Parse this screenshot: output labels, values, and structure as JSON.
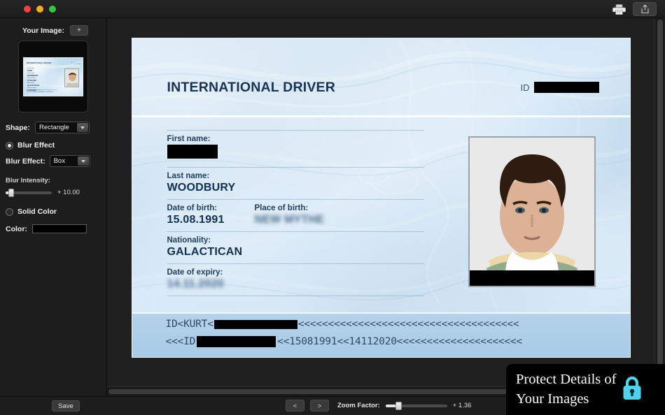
{
  "window": {
    "traffic_lights": [
      "close",
      "minimize",
      "maximize"
    ],
    "titlebar_icons": [
      "printer-icon",
      "share-export-icon"
    ]
  },
  "sidebar": {
    "your_image_label": "Your Image:",
    "add_image_label": "+",
    "shape_label": "Shape:",
    "shape_value": "Rectangle",
    "blur_effect_radio_label": "Blur Effect",
    "blur_effect_radio_selected": true,
    "blur_effect_label": "Blur Effect:",
    "blur_effect_value": "Box",
    "blur_intensity_label": "Blur Intensity:",
    "blur_intensity_value": "+ 10.00",
    "solid_color_radio_label": "Solid Color",
    "solid_color_radio_selected": false,
    "color_label": "Color:",
    "color_value": "#000000",
    "thumbnail": {
      "title": "INTERNATIONAL  DRIVER",
      "id_text": "ID ________",
      "labels": [
        "First name:",
        "Last name:",
        "Date of birth:",
        "Place of birth:",
        "Nationality:",
        "Date of expiry:"
      ],
      "values": [
        "KURT",
        "WOODBURY",
        "15.08.1991",
        "NEW MYTHE",
        "GALACTICAN",
        "14.11.2020"
      ],
      "mrz_1": "ID<KURT<WOODBURY<<<<<<<<<<<<<<<<<<<",
      "mrz_2": "<<<ID 1234567<<15081991<<14112020<<<"
    }
  },
  "card": {
    "title": "INTERNATIONAL DRIVER",
    "id_label": "ID",
    "id_redacted": true,
    "fields": [
      {
        "label": "First name:",
        "value": "",
        "redacted": true,
        "blurred": false
      },
      {
        "label": "Last name:",
        "value": "WOODBURY",
        "redacted": false,
        "blurred": false
      },
      {
        "label": "Date of birth:",
        "value": "15.08.1991",
        "redacted": false,
        "blurred": false
      },
      {
        "label": "Place of birth:",
        "value": "NEW MYTHE",
        "redacted": false,
        "blurred": true
      },
      {
        "label": "Nationality:",
        "value": "GALACTICAN",
        "redacted": false,
        "blurred": false
      },
      {
        "label": "Date of expiry:",
        "value": "14.11.2020",
        "redacted": false,
        "blurred": true
      }
    ],
    "mrz": {
      "line1_prefix": "ID<KURT<",
      "line1_suffix": "<<<<<<<<<<<<<<<<<<<<<<<<<<<<<<<<<<<<<",
      "line2_prefix": "<<<ID ",
      "line2_suffix": "<<15081991<<14112020<<<<<<<<<<<<<<<<<<<<<"
    },
    "photo_redacted": true
  },
  "bottombar": {
    "save_label": "Save",
    "prev_label": "<",
    "next_label": ">",
    "zoom_factor_label": "Zoom Factor:",
    "zoom_factor_value": "+ 1.36"
  },
  "watermark": {
    "line1": "Protect Details of",
    "line2": "Your Images",
    "lock_icon": "lock-icon",
    "lock_color": "#4fd2ea"
  }
}
